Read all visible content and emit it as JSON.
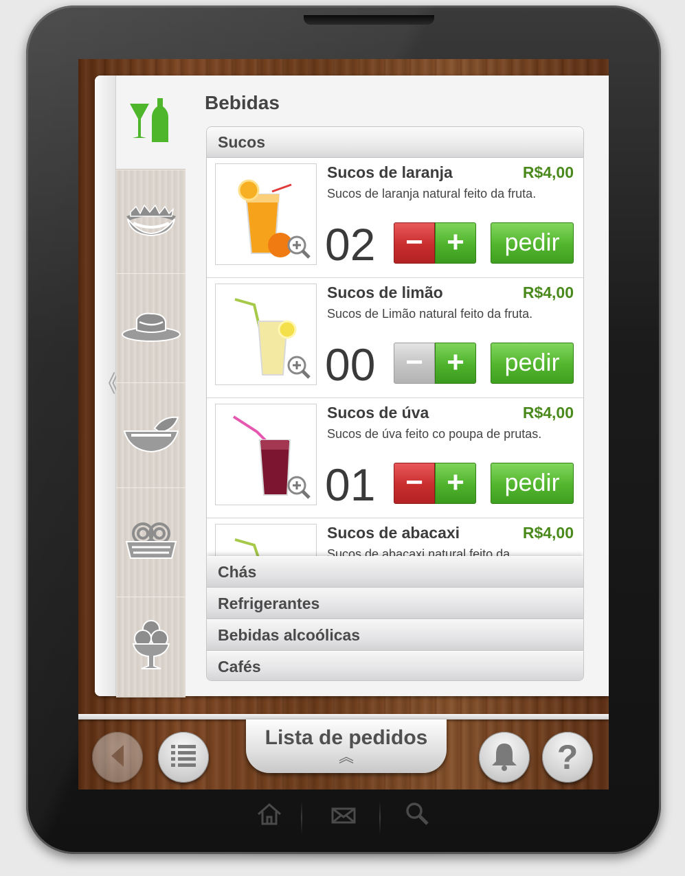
{
  "colors": {
    "accent_green": "#4eb22c",
    "price_green": "#4a8a1c",
    "minus_red": "#c92d2e",
    "disabled_grey": "#c4c4c4",
    "wood_brown": "#6a3a1a"
  },
  "sidebar": {
    "collapse_glyph": "《",
    "categories": [
      {
        "icon": "drinks-icon",
        "active": true
      },
      {
        "icon": "salad-bowl-icon",
        "active": false
      },
      {
        "icon": "meat-plate-icon",
        "active": false
      },
      {
        "icon": "leaf-bowl-icon",
        "active": false
      },
      {
        "icon": "pasta-icon",
        "active": false
      },
      {
        "icon": "ice-cream-icon",
        "active": false
      }
    ]
  },
  "main": {
    "title": "Bebidas",
    "open_section": "Sucos",
    "items": [
      {
        "name": "Sucos de laranja",
        "price": "R$4,00",
        "desc": "Sucos de laranja natural feito da fruta.",
        "qty": "02",
        "minus": "−",
        "plus": "+",
        "order": "pedir",
        "minus_enabled": true
      },
      {
        "name": "Sucos de limão",
        "price": "R$4,00",
        "desc": "Sucos de Limão natural feito da fruta.",
        "qty": "00",
        "minus": "−",
        "plus": "+",
        "order": "pedir",
        "minus_enabled": false
      },
      {
        "name": "Sucos de úva",
        "price": "R$4,00",
        "desc": "Sucos de úva feito co poupa de prutas.",
        "qty": "01",
        "minus": "−",
        "plus": "+",
        "order": "pedir",
        "minus_enabled": true
      },
      {
        "name": "Sucos de abacaxi",
        "price": "R$4,00",
        "desc": "Sucos de abacaxi natural feito da",
        "qty": "",
        "minus": "",
        "plus": "",
        "order": "",
        "minus_enabled": true
      }
    ],
    "sections": [
      "Chás",
      "Refrigerantes",
      "Bebidas alcoólicas",
      "Cafés"
    ]
  },
  "bottom_bar": {
    "orders_tab_label": "Lista de pedidos",
    "orders_tab_chevron": "︽",
    "back_icon": "back-arrow-icon",
    "menu_icon": "list-icon",
    "bell_icon": "bell-icon",
    "help_label": "?"
  },
  "hardware_nav": [
    "home-icon",
    "mail-icon",
    "search-icon"
  ]
}
